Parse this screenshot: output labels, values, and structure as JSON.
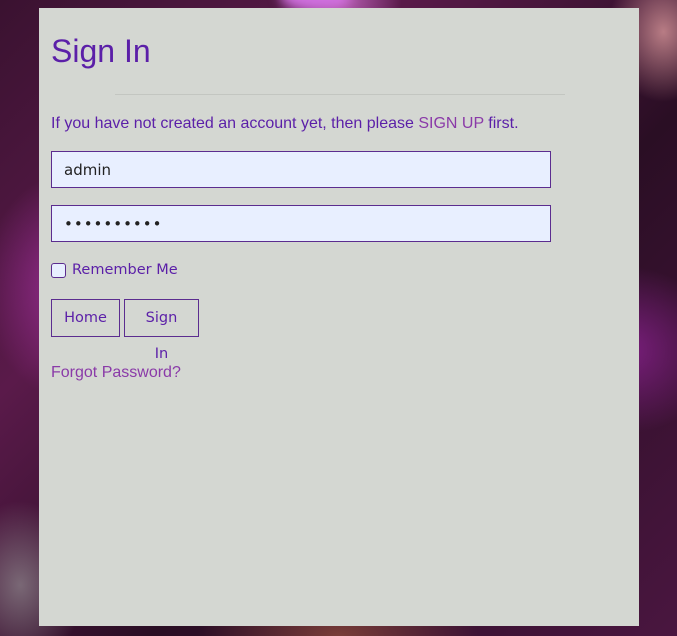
{
  "page": {
    "title": "Sign In",
    "intro_prefix": "If you have not created an account yet, then please ",
    "signup_link": "SIGN UP",
    "intro_suffix": " first."
  },
  "form": {
    "username_value": "admin",
    "password_value": "••••••••••",
    "remember_label": "Remember Me",
    "remember_checked": false
  },
  "buttons": {
    "home_label": "Home",
    "signin_label": "Sign In"
  },
  "links": {
    "forgot_password": "Forgot Password?"
  },
  "colors": {
    "accent": "#5b1fa8",
    "link": "#8a3aa8",
    "panel_bg": "#d4d7d2",
    "input_bg": "#e8efff"
  }
}
